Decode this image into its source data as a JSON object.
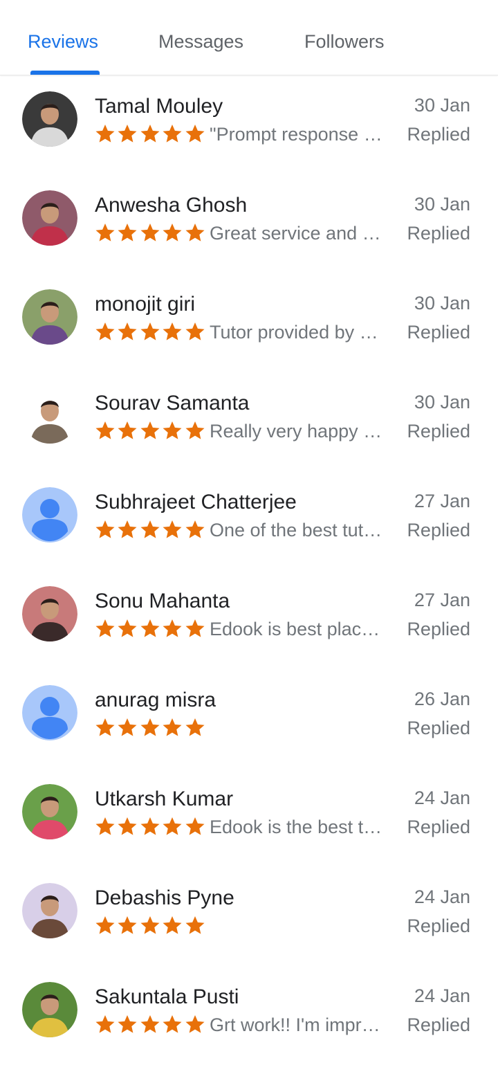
{
  "tabs": [
    {
      "label": "Reviews",
      "active": true
    },
    {
      "label": "Messages",
      "active": false
    },
    {
      "label": "Followers",
      "active": false
    }
  ],
  "colors": {
    "accent": "#1a73e8",
    "star": "#e8710a",
    "text_primary": "#202124",
    "text_secondary": "#70757a"
  },
  "reviews": [
    {
      "name": "Tamal Mouley",
      "rating": 5,
      "snippet": "\"Prompt response from tutors",
      "date": "30 Jan",
      "status": "Replied",
      "avatar": {
        "type": "photo",
        "bg": "#3a3a3a",
        "fg": "#d9d9d9"
      }
    },
    {
      "name": "Anwesha Ghosh",
      "rating": 5,
      "snippet": "Great service and tutors",
      "date": "30 Jan",
      "status": "Replied",
      "avatar": {
        "type": "photo",
        "bg": "#8f5a6a",
        "fg": "#c0304a"
      }
    },
    {
      "name": "monojit giri",
      "rating": 5,
      "snippet": "Tutor provided by Edook",
      "date": "30 Jan",
      "status": "Replied",
      "avatar": {
        "type": "photo",
        "bg": "#8aa06a",
        "fg": "#6a4a8a"
      }
    },
    {
      "name": "Sourav Samanta",
      "rating": 5,
      "snippet": "Really very happy to get",
      "date": "30 Jan",
      "status": "Replied",
      "avatar": {
        "type": "photo",
        "bg": "#ffffff",
        "fg": "#7a6a5a"
      }
    },
    {
      "name": "Subhrajeet Chatterjee",
      "rating": 5,
      "snippet": "One of the best tutors",
      "date": "27 Jan",
      "status": "Replied",
      "avatar": {
        "type": "default",
        "bg": "#a8c7fa",
        "fg": "#4285f4"
      }
    },
    {
      "name": "Sonu Mahanta",
      "rating": 5,
      "snippet": "Edook is best place for",
      "date": "27 Jan",
      "status": "Replied",
      "avatar": {
        "type": "photo",
        "bg": "#c87a7a",
        "fg": "#3a2a2a"
      }
    },
    {
      "name": "anurag misra",
      "rating": 5,
      "snippet": "",
      "date": "26 Jan",
      "status": "Replied",
      "avatar": {
        "type": "default",
        "bg": "#a8c7fa",
        "fg": "#4285f4"
      }
    },
    {
      "name": "Utkarsh Kumar",
      "rating": 5,
      "snippet": "Edook is the best tutor",
      "date": "24 Jan",
      "status": "Replied",
      "avatar": {
        "type": "photo",
        "bg": "#6aa04a",
        "fg": "#e04a6a"
      }
    },
    {
      "name": "Debashis Pyne",
      "rating": 5,
      "snippet": "",
      "date": "24 Jan",
      "status": "Replied",
      "avatar": {
        "type": "photo",
        "bg": "#d8cfe8",
        "fg": "#6a4a3a"
      }
    },
    {
      "name": "Sakuntala Pusti",
      "rating": 5,
      "snippet": "Grt work!! I'm impressed",
      "date": "24 Jan",
      "status": "Replied",
      "avatar": {
        "type": "photo",
        "bg": "#5a8a3a",
        "fg": "#e0c040"
      }
    }
  ]
}
